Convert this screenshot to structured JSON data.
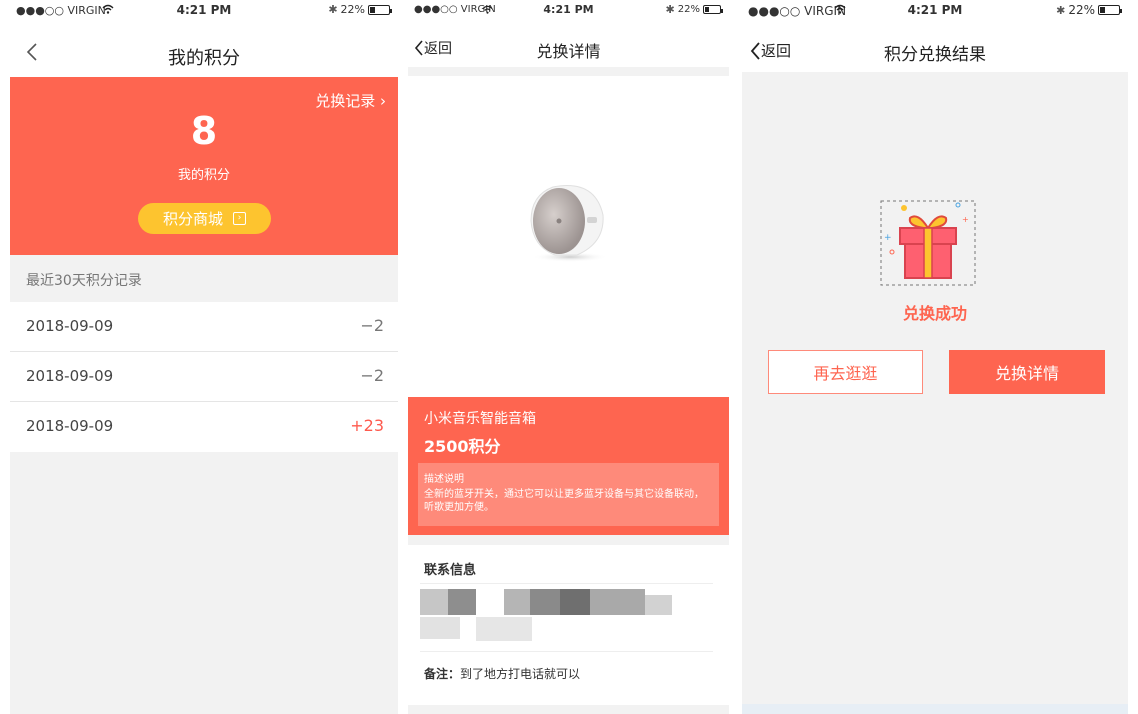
{
  "status_bar": {
    "carrier": "●●●○○ VIRGIN",
    "time": "4:21 PM",
    "battery": "22%"
  },
  "screen1": {
    "title": "我的积分",
    "records_link": "兑换记录 ›",
    "points_value": "8",
    "points_label": "我的积分",
    "mall_button": "积分商城",
    "section_header": "最近30天积分记录",
    "records": [
      {
        "date": "2018-09-09",
        "value": "−2"
      },
      {
        "date": "2018-09-09",
        "value": "−2"
      },
      {
        "date": "2018-09-09",
        "value": "+23"
      }
    ]
  },
  "screen2": {
    "back": "返回",
    "title": "兑换详情",
    "product_name": "小米音乐智能音箱",
    "product_points": "2500积分",
    "desc_title": "描述说明",
    "desc_text": "全新的蓝牙开关，通过它可以让更多蓝牙设备与其它设备联动，听歌更加方便。",
    "contact_title": "联系信息",
    "note_label": "备注：",
    "note_text": "到了地方打电话就可以"
  },
  "screen3": {
    "back": "返回",
    "title": "积分兑换结果",
    "success_text": "兑换成功",
    "button_browse": "再去逛逛",
    "button_details": "兑换详情"
  },
  "colors": {
    "accent": "#fe6550",
    "yellow": "#fdc42f",
    "background": "#f2f2f2"
  }
}
